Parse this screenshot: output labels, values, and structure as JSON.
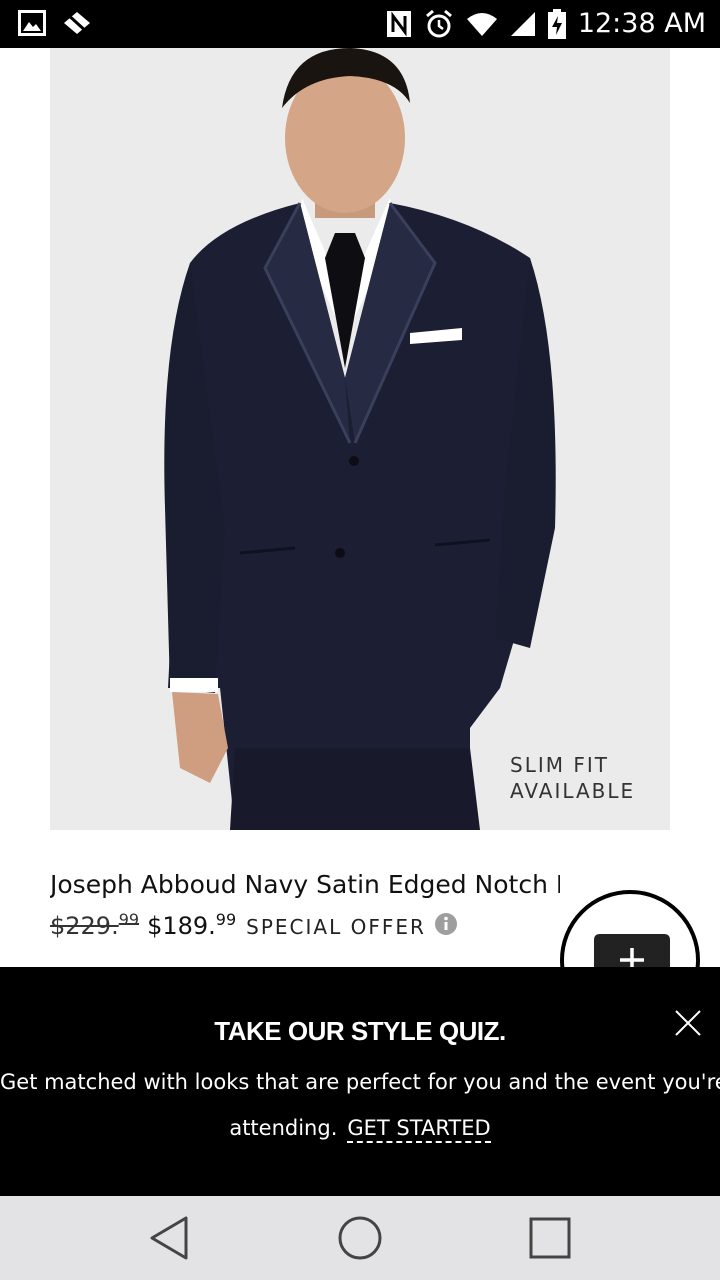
{
  "status_bar": {
    "time": "12:38 AM",
    "icons": [
      "image-icon",
      "no-location-icon",
      "nfc-icon",
      "alarm-icon",
      "wifi-icon",
      "signal-icon",
      "battery-charging-icon"
    ]
  },
  "product": {
    "badge_line1": "SLIM FIT",
    "badge_line2": "AVAILABLE",
    "title": "Joseph Abboud Navy Satin Edged Notch Lapel",
    "old_price_main": "$229.",
    "old_price_cents": "99",
    "new_price_main": "$189.",
    "new_price_cents": "99",
    "offer_label": "SPECIAL OFFER",
    "info_icon": "info-icon"
  },
  "chat": {
    "icon": "chat-add-icon"
  },
  "quiz_banner": {
    "title": "TAKE OUR STYLE QUIZ.",
    "body_line1": "Get matched with looks that are perfect for you and the event you're",
    "body_line2": "attending.",
    "cta": "GET STARTED",
    "close_icon": "close-icon"
  },
  "nav_bar": {
    "icons": [
      "back-icon",
      "home-icon",
      "recents-icon"
    ]
  },
  "colors": {
    "banner_bg": "#000000",
    "nav_bg": "#e3e3e6",
    "image_bg": "#ebebeb",
    "suit_navy": "#1c1f33"
  }
}
